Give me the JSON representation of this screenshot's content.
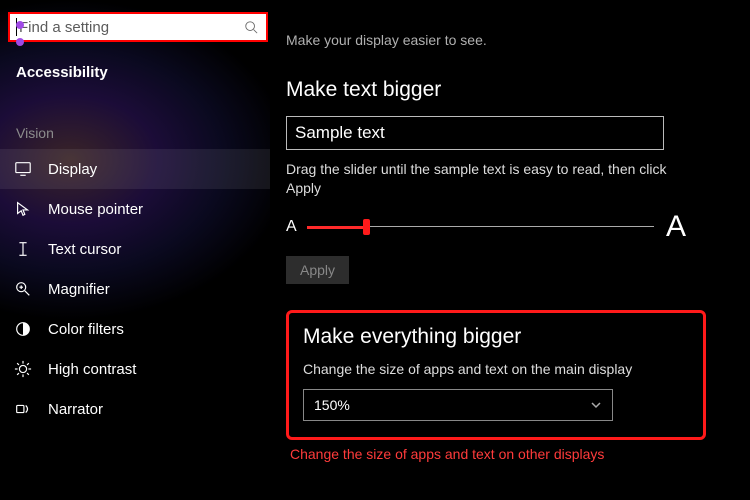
{
  "search": {
    "placeholder": "Find a setting"
  },
  "sidebar": {
    "title": "Accessibility",
    "section": "Vision",
    "items": [
      {
        "label": "Display"
      },
      {
        "label": "Mouse pointer"
      },
      {
        "label": "Text cursor"
      },
      {
        "label": "Magnifier"
      },
      {
        "label": "Color filters"
      },
      {
        "label": "High contrast"
      },
      {
        "label": "Narrator"
      }
    ]
  },
  "main": {
    "intro": "Make your display easier to see.",
    "text_bigger": {
      "heading": "Make text bigger",
      "sample": "Sample text",
      "instruction": "Drag the slider until the sample text is easy to read, then click Apply",
      "a_small": "A",
      "a_big": "A",
      "apply": "Apply"
    },
    "everything_bigger": {
      "heading": "Make everything bigger",
      "sub": "Change the size of apps and text on the main display",
      "value": "150%"
    },
    "other_displays_link": "Change the size of apps and text on other displays"
  }
}
